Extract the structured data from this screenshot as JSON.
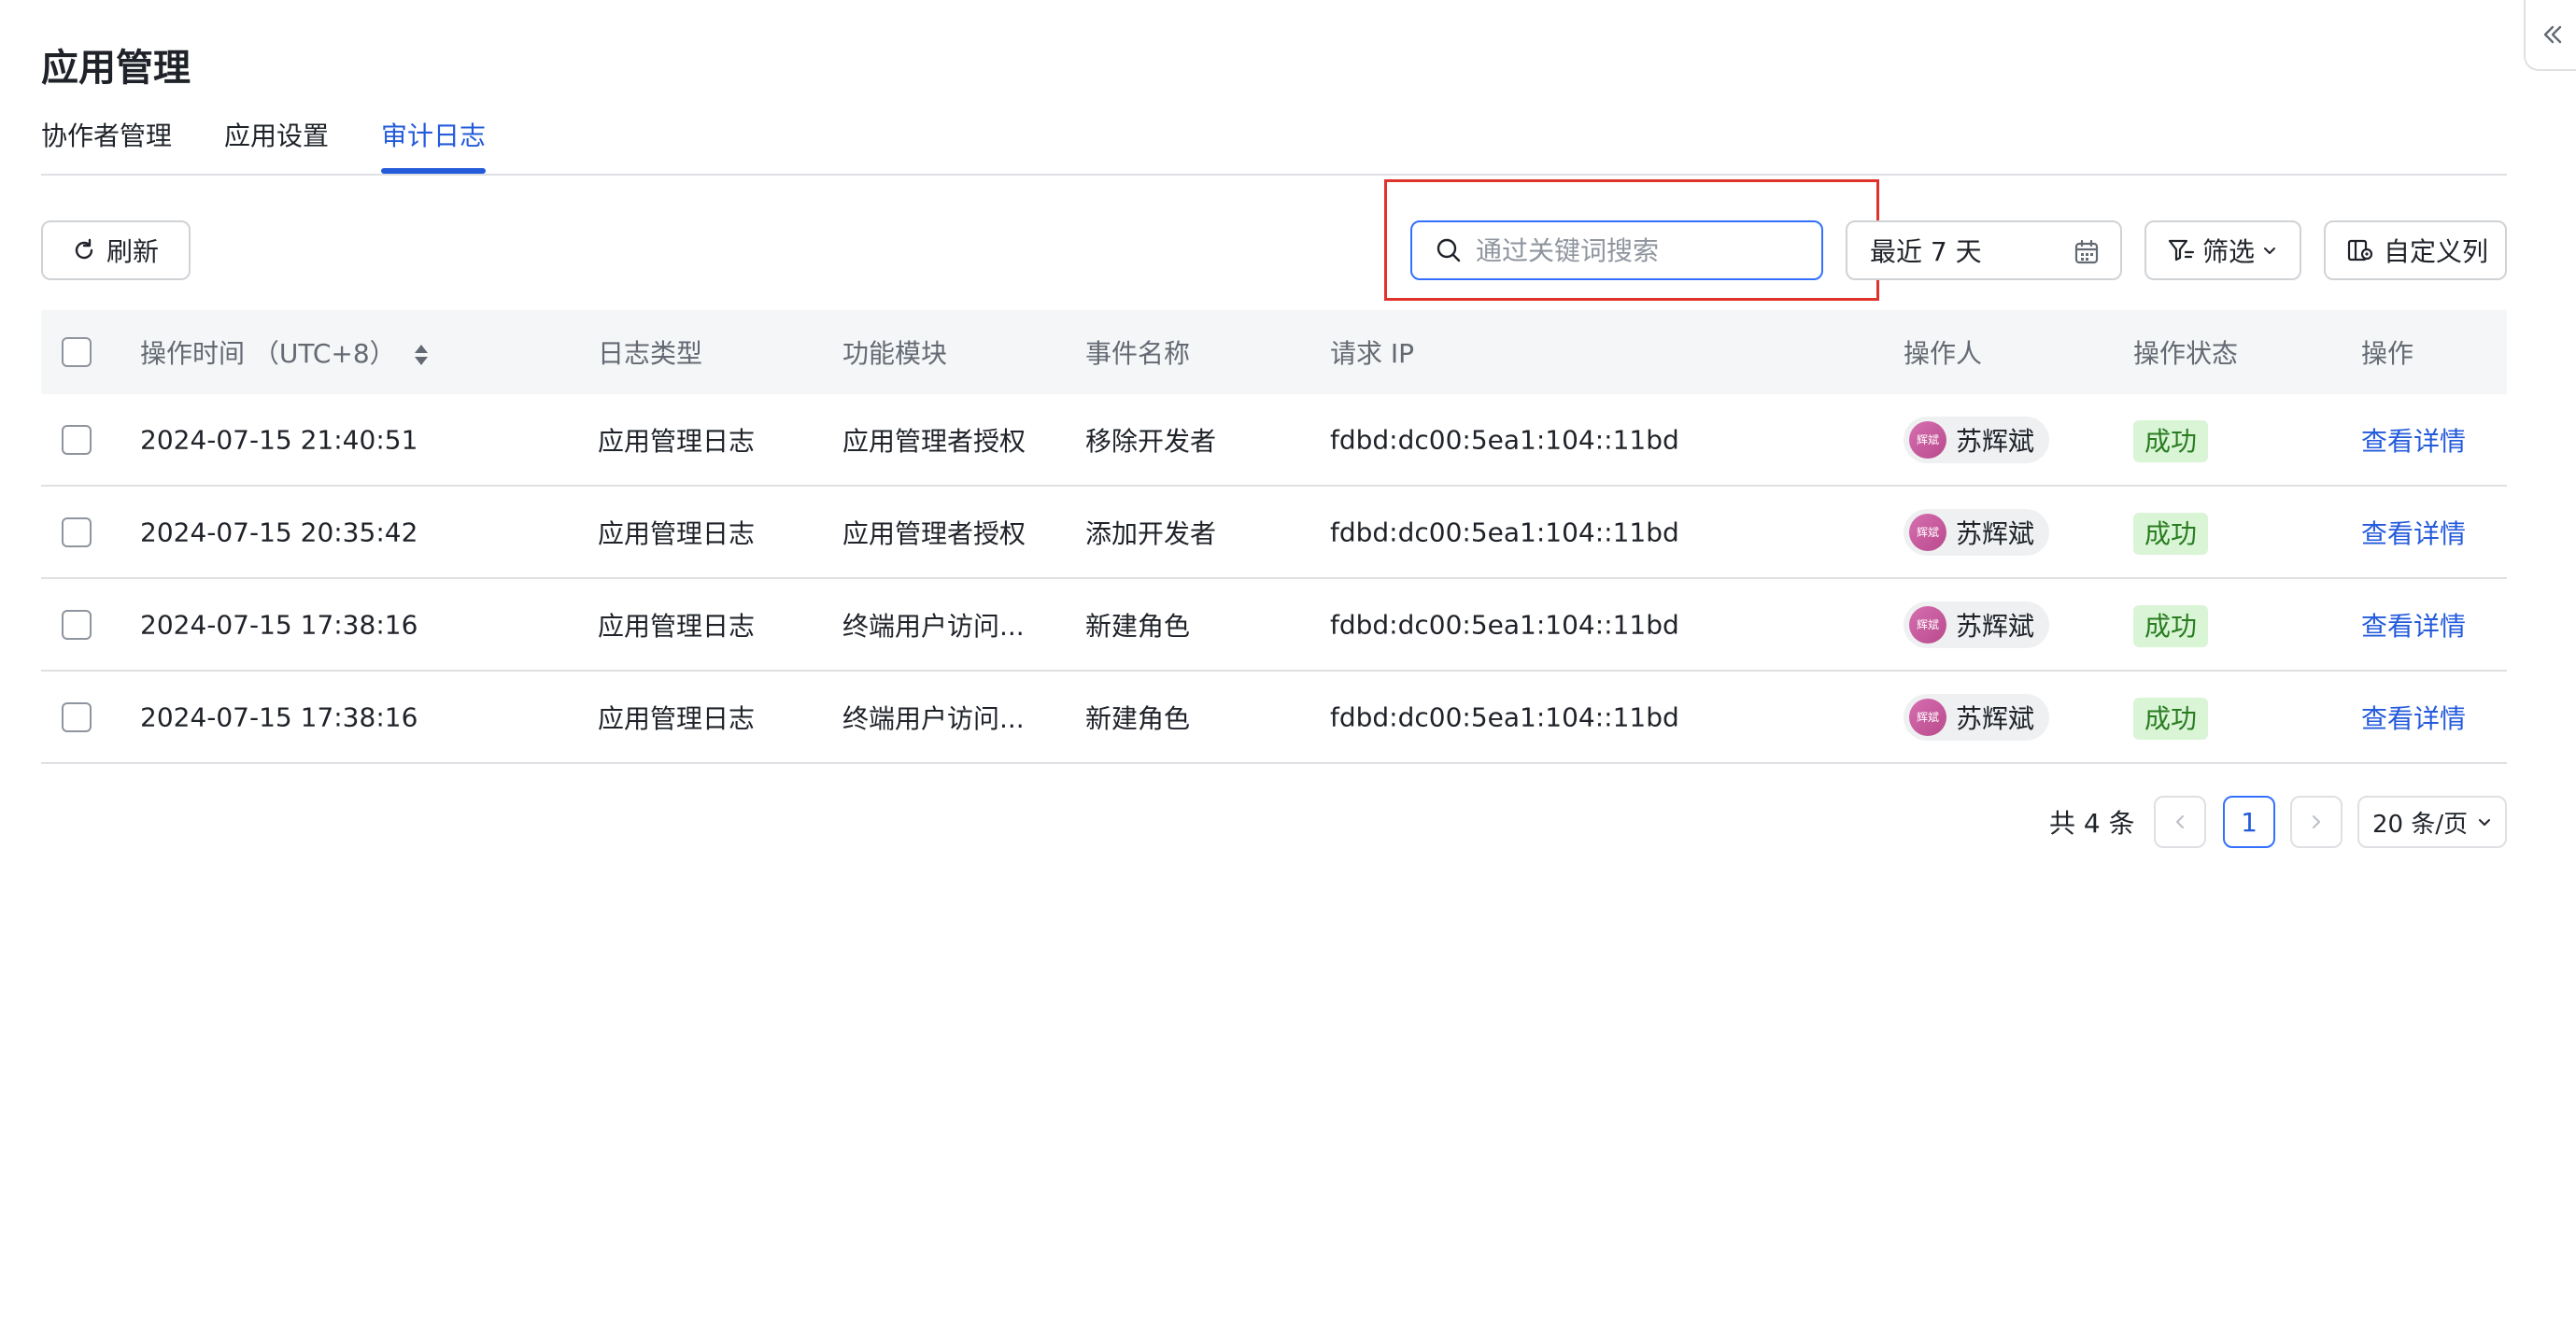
{
  "page": {
    "title": "应用管理"
  },
  "tabs": [
    {
      "label": "协作者管理",
      "active": false
    },
    {
      "label": "应用设置",
      "active": false
    },
    {
      "label": "审计日志",
      "active": true
    }
  ],
  "toolbar": {
    "refresh_label": "刷新",
    "search_placeholder": "通过关键词搜索",
    "search_value": "",
    "date_range": "最近 7 天",
    "filter_label": "筛选",
    "custom_columns_label": "自定义列"
  },
  "table": {
    "headers": {
      "time": "操作时间 （UTC+8）",
      "type": "日志类型",
      "module": "功能模块",
      "event": "事件名称",
      "ip": "请求 IP",
      "operator": "操作人",
      "status": "操作状态",
      "action": "操作"
    },
    "rows": [
      {
        "time": "2024-07-15 21:40:51",
        "type": "应用管理日志",
        "module": "应用管理者授权",
        "event": "移除开发者",
        "ip": "fdbd:dc00:5ea1:104::11bd",
        "operator": "苏辉斌",
        "avatar_text": "辉斌",
        "status": "成功",
        "action": "查看详情"
      },
      {
        "time": "2024-07-15 20:35:42",
        "type": "应用管理日志",
        "module": "应用管理者授权",
        "event": "添加开发者",
        "ip": "fdbd:dc00:5ea1:104::11bd",
        "operator": "苏辉斌",
        "avatar_text": "辉斌",
        "status": "成功",
        "action": "查看详情"
      },
      {
        "time": "2024-07-15 17:38:16",
        "type": "应用管理日志",
        "module": "终端用户访问...",
        "event": "新建角色",
        "ip": "fdbd:dc00:5ea1:104::11bd",
        "operator": "苏辉斌",
        "avatar_text": "辉斌",
        "status": "成功",
        "action": "查看详情"
      },
      {
        "time": "2024-07-15 17:38:16",
        "type": "应用管理日志",
        "module": "终端用户访问...",
        "event": "新建角色",
        "ip": "fdbd:dc00:5ea1:104::11bd",
        "operator": "苏辉斌",
        "avatar_text": "辉斌",
        "status": "成功",
        "action": "查看详情"
      }
    ]
  },
  "pagination": {
    "total_label": "共 4 条",
    "current_page": "1",
    "page_size": "20 条/页"
  },
  "colors": {
    "accent": "#245bdb",
    "highlight": "#e0322c",
    "success_bg": "#d9f5d6",
    "success_text": "#2a7c21"
  },
  "icons": [
    "collapse-icon",
    "refresh-icon",
    "search-icon",
    "calendar-icon",
    "filter-icon",
    "chevron-down-icon",
    "columns-icon",
    "sort-icon",
    "chevron-left-icon",
    "chevron-right-icon"
  ]
}
